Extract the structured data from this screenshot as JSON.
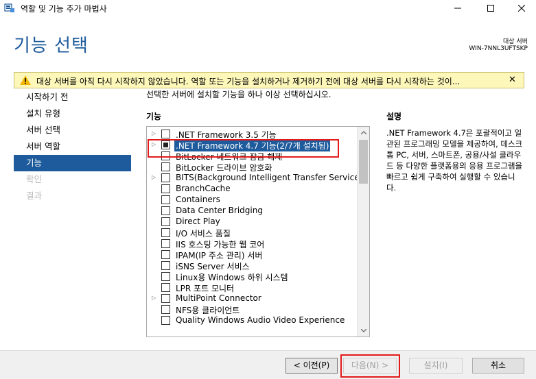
{
  "window": {
    "title": "역할 및 기능 추가 마법사",
    "minimize": "—",
    "maximize": "☐",
    "close": "✕"
  },
  "header": {
    "page_title": "기능 선택",
    "server_label": "대상 서버",
    "server_name": "WIN-7NNL3UFTSKP"
  },
  "warning": {
    "text": "대상 서버를 아직 다시 시작하지 않았습니다. 역할 또는 기능을 설치하거나 제거하기 전에 대상 서버를 다시 시작하는 것이...",
    "close": "✕"
  },
  "nav": {
    "items": [
      {
        "label": "시작하기 전",
        "state": "normal"
      },
      {
        "label": "설치 유형",
        "state": "normal"
      },
      {
        "label": "서버 선택",
        "state": "normal"
      },
      {
        "label": "서버 역할",
        "state": "normal"
      },
      {
        "label": "기능",
        "state": "active"
      },
      {
        "label": "확인",
        "state": "disabled"
      },
      {
        "label": "결과",
        "state": "disabled"
      }
    ]
  },
  "main": {
    "instruction": "선택한 서버에 설치할 기능을 하나 이상 선택하십시오.",
    "features_heading": "기능",
    "features": [
      {
        "label": ".NET Framework 3.5 기능",
        "expandable": true,
        "checked": false
      },
      {
        "label": ".NET Framework 4.7 기능(2/7개 설치됨)",
        "expandable": true,
        "checked": "partial",
        "selected": true
      },
      {
        "label": "BitLocker 네트워크 잠금 해제",
        "expandable": false,
        "checked": false
      },
      {
        "label": "BitLocker 드라이브 암호화",
        "expandable": false,
        "checked": false
      },
      {
        "label": "BITS(Background Intelligent Transfer Service)",
        "expandable": true,
        "checked": false
      },
      {
        "label": "BranchCache",
        "expandable": false,
        "checked": false
      },
      {
        "label": "Containers",
        "expandable": false,
        "checked": false
      },
      {
        "label": "Data Center Bridging",
        "expandable": false,
        "checked": false
      },
      {
        "label": "Direct Play",
        "expandable": false,
        "checked": false
      },
      {
        "label": "I/O 서비스 품질",
        "expandable": false,
        "checked": false
      },
      {
        "label": "IIS 호스팅 가능한 웹 코어",
        "expandable": false,
        "checked": false
      },
      {
        "label": "IPAM(IP 주소 관리) 서버",
        "expandable": false,
        "checked": false
      },
      {
        "label": "iSNS Server 서비스",
        "expandable": false,
        "checked": false
      },
      {
        "label": "Linux용 Windows 하위 시스템",
        "expandable": false,
        "checked": false
      },
      {
        "label": "LPR 포트 모니터",
        "expandable": false,
        "checked": false
      },
      {
        "label": "MultiPoint Connector",
        "expandable": true,
        "checked": false
      },
      {
        "label": "NFS용 클라이언트",
        "expandable": false,
        "checked": false
      },
      {
        "label": "Quality Windows Audio Video Experience",
        "expandable": false,
        "checked": false
      }
    ],
    "description_heading": "설명",
    "description": ".NET Framework 4.7은 포괄적이고 일관된 프로그래밍 모델을 제공하여, 데스크톱 PC, 서버, 스마트폰, 공용/사설 클라우드 등 다양한 플랫폼용의 응용 프로그램을 빠르고 쉽게 구축하여 실행할 수 있습니다."
  },
  "footer": {
    "prev": "< 이전(P)",
    "next": "다음(N) >",
    "install": "설치(I)",
    "cancel": "취소"
  },
  "colors": {
    "accent": "#1e5b9c",
    "warning_bg": "#fdf7b9",
    "annotation": "#e21a1a"
  }
}
